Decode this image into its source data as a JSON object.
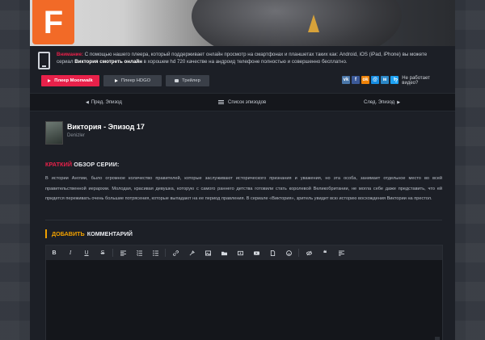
{
  "hero": {
    "logo_letter": "F"
  },
  "notice": {
    "label": "Внимание:",
    "text1": " С помощью нашего плеера, который поддерживает онлайн просмотр на смартфонах и планшетах таких как: Android, iOS (iPad, iPhone) вы можете",
    "text2a": "сериал ",
    "bold": "Виктория смотреть онлайн",
    "text2b": " в хорошем hd 720 качестве на андроид телефоне полностью и совершенно бесплатно."
  },
  "buttons": {
    "moonwalk": "Плеер Moonwalk",
    "hdgo": "Плеер HDGO",
    "trailer": "Трейлер"
  },
  "social": [
    {
      "icon": "vk-icon",
      "glyph": "vk",
      "color": "#4a76a8"
    },
    {
      "icon": "facebook-icon",
      "glyph": "f",
      "color": "#3b5998"
    },
    {
      "icon": "odnoklassniki-icon",
      "glyph": "ok",
      "color": "#ee8208"
    },
    {
      "icon": "mail-icon",
      "glyph": "@",
      "color": "#168de2"
    },
    {
      "icon": "moimir-icon",
      "glyph": "м",
      "color": "#2b87c6"
    },
    {
      "icon": "twitter-icon",
      "glyph": "t",
      "color": "#1da1f2"
    }
  ],
  "help": {
    "q": "?",
    "text": "Не работает видео?"
  },
  "episode_nav": {
    "prev": "Пред. Эпизод",
    "list": "Список эпизодов",
    "next": "След. Эпизод"
  },
  "episode": {
    "title": "Виктория - Эпизод 17",
    "subtitle": "Denizler"
  },
  "summary": {
    "title_highlight": "КРАТКИЙ",
    "title_rest": " ОБЗОР СЕРИИ:",
    "text": "В истории Англии, было огромное количество правителей, которые заслуживают исторического признания и уважения, но эта особа, занимает отдельное место во всей правительственной иерархии. Молодая, красивая девушка, которую с самого раннего детства готовили стать королевой Великобритании, не могла себе даже представить, что ей придется переживать очень большие потрясения, которые выпадают на ее период правления. В сериале «Виктория», зритель увидит всю историю восхождения Виктории на престол."
  },
  "comment": {
    "title_highlight": "ДОБАВИТЬ",
    "title_rest": "КОММЕНТАРИЙ"
  },
  "toolbar": {
    "bold": "B",
    "italic": "I",
    "underline": "U",
    "strike": "S"
  }
}
